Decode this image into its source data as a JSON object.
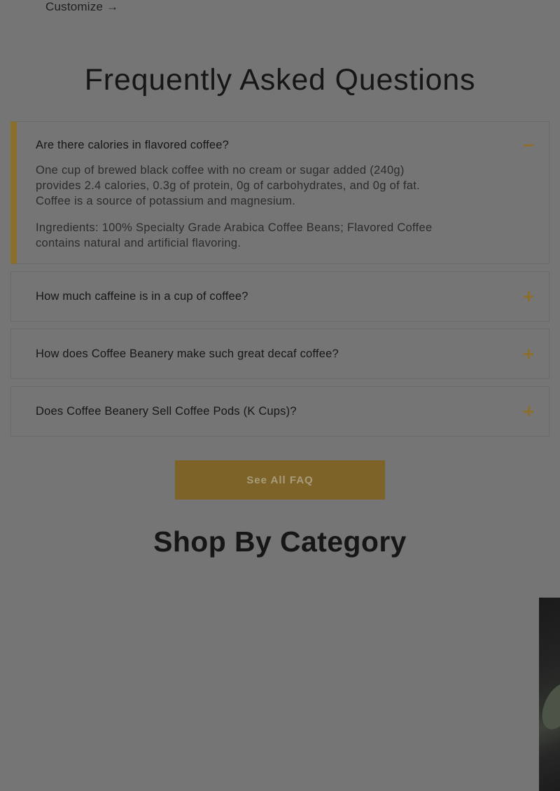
{
  "customize_link": "Customize →",
  "faq": {
    "title": "Frequently Asked Questions",
    "items": [
      {
        "question": "Are there calories in flavored coffee?",
        "expanded": true,
        "answer": [
          "One cup of brewed black coffee with no cream or sugar added (240g) provides 2.4 calories, 0.3g of protein, 0g of carbohydrates, and 0g of fat. Coffee is a source of potassium and magnesium.",
          "Ingredients: 100% Specialty Grade Arabica Coffee Beans; Flavored Coffee contains natural and artificial flavoring."
        ],
        "toggle_icon": "minus-icon"
      },
      {
        "question": "How much caffeine is in a cup of coffee?",
        "expanded": false,
        "toggle_icon": "plus-icon"
      },
      {
        "question": "How does Coffee Beanery make such great decaf coffee?",
        "expanded": false,
        "toggle_icon": "plus-icon"
      },
      {
        "question": "Does Coffee Beanery Sell Coffee Pods (K Cups)?",
        "expanded": false,
        "toggle_icon": "plus-icon"
      }
    ],
    "see_all_label": "See All FAQ"
  },
  "shop": {
    "title": "Shop By Category"
  },
  "colors": {
    "overlay_background": "#757575",
    "accent_gold": "#8b6d2c",
    "button_background": "#7e6328"
  }
}
